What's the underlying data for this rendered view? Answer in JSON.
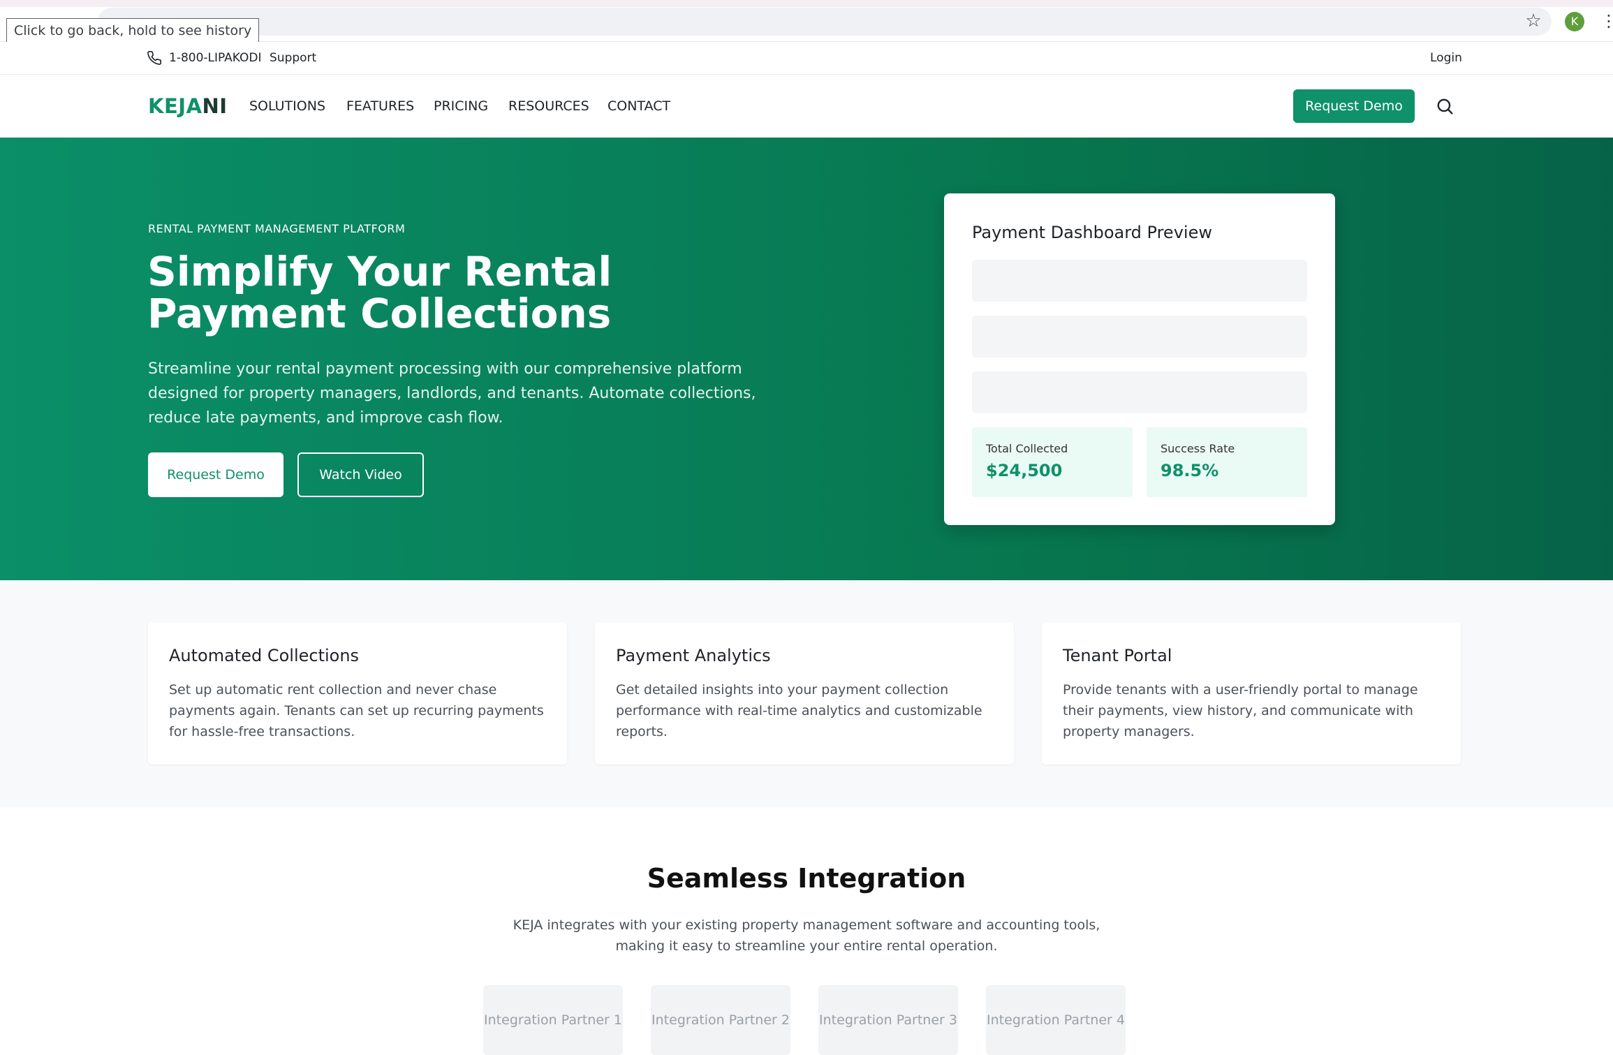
{
  "browser": {
    "tooltip": "Click to go back, hold to see history",
    "avatar_letter": "K",
    "star_icon": "star-icon",
    "menu_icon": "kebab-menu-icon"
  },
  "topbar": {
    "phone": "1-800-LIPAKODI",
    "support": "Support",
    "login": "Login"
  },
  "nav": {
    "logo_part1": "KEJA",
    "logo_part2": "NI",
    "links": [
      "SOLUTIONS",
      "FEATURES",
      "PRICING",
      "RESOURCES",
      "CONTACT"
    ],
    "cta": "Request Demo"
  },
  "hero": {
    "eyebrow": "RENTAL PAYMENT MANAGEMENT PLATFORM",
    "title_line1": "Simplify Your Rental",
    "title_line2": "Payment Collections",
    "lead": "Streamline your rental payment processing with our comprehensive platform designed for property managers, landlords, and tenants. Automate collections, reduce late payments, and improve cash flow.",
    "primary_button": "Request Demo",
    "secondary_button": "Watch Video",
    "dashboard": {
      "title": "Payment Dashboard Preview",
      "stats": [
        {
          "label": "Total Collected",
          "value": "$24,500"
        },
        {
          "label": "Success Rate",
          "value": "98.5%"
        }
      ]
    }
  },
  "features": [
    {
      "title": "Automated Collections",
      "description": "Set up automatic rent collection and never chase payments again. Tenants can set up recurring payments for hassle-free transactions."
    },
    {
      "title": "Payment Analytics",
      "description": "Get detailed insights into your payment collection performance with real-time analytics and customizable reports."
    },
    {
      "title": "Tenant Portal",
      "description": "Provide tenants with a user-friendly portal to manage their payments, view history, and communicate with property managers."
    }
  ],
  "integration": {
    "title": "Seamless Integration",
    "text": "KEJA integrates with your existing property management software and accounting tools, making it easy to streamline your entire rental operation.",
    "partners": [
      "Integration Partner 1",
      "Integration Partner 2",
      "Integration Partner 3",
      "Integration Partner 4"
    ]
  },
  "colors": {
    "brand_green": "#0f9169",
    "hero_gradient_start": "#0a8f68",
    "hero_gradient_end": "#066347"
  }
}
